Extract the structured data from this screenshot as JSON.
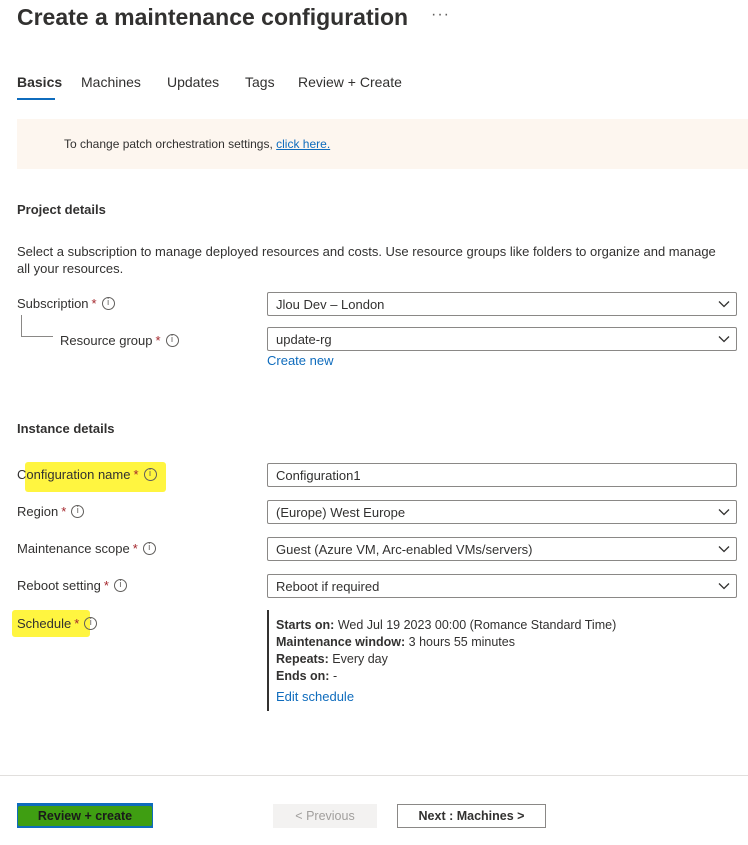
{
  "header": {
    "title": "Create a maintenance configuration",
    "more_label": "···"
  },
  "tabs": [
    {
      "label": "Basics",
      "active": true
    },
    {
      "label": "Machines"
    },
    {
      "label": "Updates"
    },
    {
      "label": "Tags"
    },
    {
      "label": "Review + Create"
    }
  ],
  "banner": {
    "text": "To change patch orchestration settings,",
    "link_text": "click here."
  },
  "project": {
    "heading": "Project details",
    "description": "Select a subscription to manage deployed resources and costs. Use resource groups like folders to organize and manage all your resources.",
    "subscription_label": "Subscription",
    "subscription_value": "Jlou Dev – London",
    "resource_group_label": "Resource group",
    "resource_group_value": "update-rg",
    "create_new": "Create new"
  },
  "instance": {
    "heading": "Instance details",
    "config_name_label": "Configuration name",
    "config_name_value": "Configuration1",
    "region_label": "Region",
    "region_value": "(Europe) West Europe",
    "scope_label": "Maintenance scope",
    "scope_value": "Guest (Azure VM, Arc-enabled VMs/servers)",
    "reboot_label": "Reboot setting",
    "reboot_value": "Reboot if required",
    "schedule_label": "Schedule"
  },
  "schedule": {
    "starts_on_label": "Starts on:",
    "starts_on_value": "Wed Jul 19 2023 00:00 (Romance Standard Time)",
    "window_label": "Maintenance window:",
    "window_value": "3 hours 55 minutes",
    "repeats_label": "Repeats:",
    "repeats_value": "Every day",
    "ends_label": "Ends on:",
    "ends_value": "-",
    "edit_link": "Edit schedule"
  },
  "footer": {
    "review_create": "Review + create",
    "previous": "< Previous",
    "next": "Next : Machines >"
  },
  "common": {
    "required_mark": "*",
    "info_glyph": "i"
  },
  "colors": {
    "accent": "#0f6cbd",
    "banner_bg": "#fdf6ef",
    "highlight": "#fff200",
    "primary_button_highlight": "#3f9e12",
    "required": "#a4262c"
  },
  "icons": [
    "more-icon",
    "info-icon",
    "chevron-down-icon"
  ]
}
